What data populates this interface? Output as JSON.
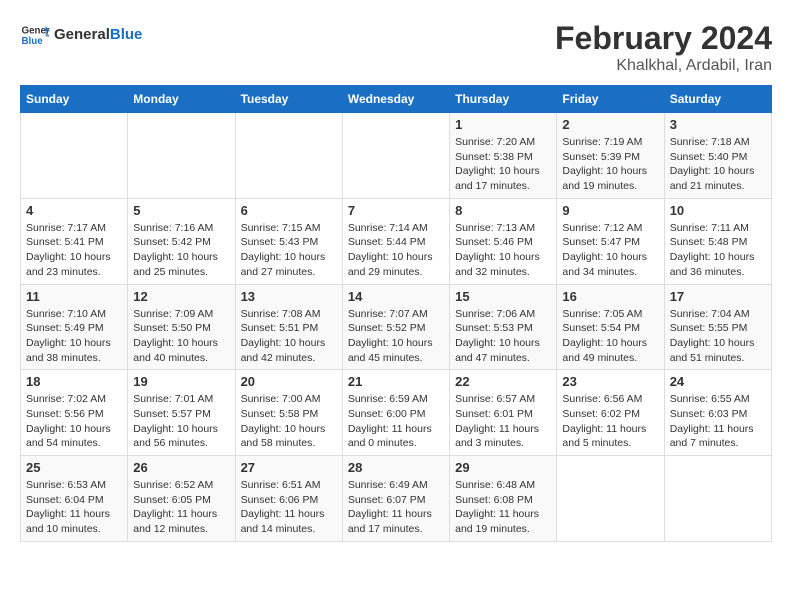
{
  "header": {
    "logo_general": "General",
    "logo_blue": "Blue",
    "title": "February 2024",
    "subtitle": "Khalkhal, Ardabil, Iran"
  },
  "weekdays": [
    "Sunday",
    "Monday",
    "Tuesday",
    "Wednesday",
    "Thursday",
    "Friday",
    "Saturday"
  ],
  "weeks": [
    [
      {
        "day": "",
        "info": ""
      },
      {
        "day": "",
        "info": ""
      },
      {
        "day": "",
        "info": ""
      },
      {
        "day": "",
        "info": ""
      },
      {
        "day": "1",
        "info": "Sunrise: 7:20 AM\nSunset: 5:38 PM\nDaylight: 10 hours\nand 17 minutes."
      },
      {
        "day": "2",
        "info": "Sunrise: 7:19 AM\nSunset: 5:39 PM\nDaylight: 10 hours\nand 19 minutes."
      },
      {
        "day": "3",
        "info": "Sunrise: 7:18 AM\nSunset: 5:40 PM\nDaylight: 10 hours\nand 21 minutes."
      }
    ],
    [
      {
        "day": "4",
        "info": "Sunrise: 7:17 AM\nSunset: 5:41 PM\nDaylight: 10 hours\nand 23 minutes."
      },
      {
        "day": "5",
        "info": "Sunrise: 7:16 AM\nSunset: 5:42 PM\nDaylight: 10 hours\nand 25 minutes."
      },
      {
        "day": "6",
        "info": "Sunrise: 7:15 AM\nSunset: 5:43 PM\nDaylight: 10 hours\nand 27 minutes."
      },
      {
        "day": "7",
        "info": "Sunrise: 7:14 AM\nSunset: 5:44 PM\nDaylight: 10 hours\nand 29 minutes."
      },
      {
        "day": "8",
        "info": "Sunrise: 7:13 AM\nSunset: 5:46 PM\nDaylight: 10 hours\nand 32 minutes."
      },
      {
        "day": "9",
        "info": "Sunrise: 7:12 AM\nSunset: 5:47 PM\nDaylight: 10 hours\nand 34 minutes."
      },
      {
        "day": "10",
        "info": "Sunrise: 7:11 AM\nSunset: 5:48 PM\nDaylight: 10 hours\nand 36 minutes."
      }
    ],
    [
      {
        "day": "11",
        "info": "Sunrise: 7:10 AM\nSunset: 5:49 PM\nDaylight: 10 hours\nand 38 minutes."
      },
      {
        "day": "12",
        "info": "Sunrise: 7:09 AM\nSunset: 5:50 PM\nDaylight: 10 hours\nand 40 minutes."
      },
      {
        "day": "13",
        "info": "Sunrise: 7:08 AM\nSunset: 5:51 PM\nDaylight: 10 hours\nand 42 minutes."
      },
      {
        "day": "14",
        "info": "Sunrise: 7:07 AM\nSunset: 5:52 PM\nDaylight: 10 hours\nand 45 minutes."
      },
      {
        "day": "15",
        "info": "Sunrise: 7:06 AM\nSunset: 5:53 PM\nDaylight: 10 hours\nand 47 minutes."
      },
      {
        "day": "16",
        "info": "Sunrise: 7:05 AM\nSunset: 5:54 PM\nDaylight: 10 hours\nand 49 minutes."
      },
      {
        "day": "17",
        "info": "Sunrise: 7:04 AM\nSunset: 5:55 PM\nDaylight: 10 hours\nand 51 minutes."
      }
    ],
    [
      {
        "day": "18",
        "info": "Sunrise: 7:02 AM\nSunset: 5:56 PM\nDaylight: 10 hours\nand 54 minutes."
      },
      {
        "day": "19",
        "info": "Sunrise: 7:01 AM\nSunset: 5:57 PM\nDaylight: 10 hours\nand 56 minutes."
      },
      {
        "day": "20",
        "info": "Sunrise: 7:00 AM\nSunset: 5:58 PM\nDaylight: 10 hours\nand 58 minutes."
      },
      {
        "day": "21",
        "info": "Sunrise: 6:59 AM\nSunset: 6:00 PM\nDaylight: 11 hours\nand 0 minutes."
      },
      {
        "day": "22",
        "info": "Sunrise: 6:57 AM\nSunset: 6:01 PM\nDaylight: 11 hours\nand 3 minutes."
      },
      {
        "day": "23",
        "info": "Sunrise: 6:56 AM\nSunset: 6:02 PM\nDaylight: 11 hours\nand 5 minutes."
      },
      {
        "day": "24",
        "info": "Sunrise: 6:55 AM\nSunset: 6:03 PM\nDaylight: 11 hours\nand 7 minutes."
      }
    ],
    [
      {
        "day": "25",
        "info": "Sunrise: 6:53 AM\nSunset: 6:04 PM\nDaylight: 11 hours\nand 10 minutes."
      },
      {
        "day": "26",
        "info": "Sunrise: 6:52 AM\nSunset: 6:05 PM\nDaylight: 11 hours\nand 12 minutes."
      },
      {
        "day": "27",
        "info": "Sunrise: 6:51 AM\nSunset: 6:06 PM\nDaylight: 11 hours\nand 14 minutes."
      },
      {
        "day": "28",
        "info": "Sunrise: 6:49 AM\nSunset: 6:07 PM\nDaylight: 11 hours\nand 17 minutes."
      },
      {
        "day": "29",
        "info": "Sunrise: 6:48 AM\nSunset: 6:08 PM\nDaylight: 11 hours\nand 19 minutes."
      },
      {
        "day": "",
        "info": ""
      },
      {
        "day": "",
        "info": ""
      }
    ]
  ]
}
